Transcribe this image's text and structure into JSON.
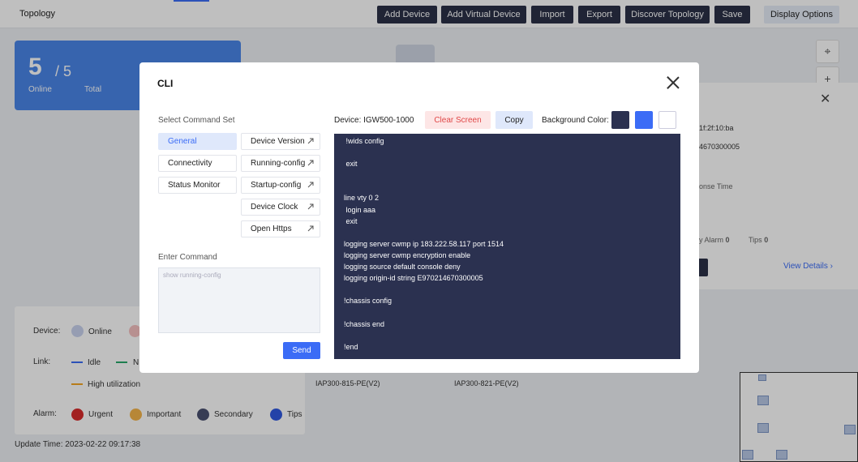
{
  "app": {
    "title": "Topology"
  },
  "toolbar": {
    "buttons": [
      {
        "label": "Add Device"
      },
      {
        "label": "Add Virtual Device"
      },
      {
        "label": "Import"
      },
      {
        "label": "Export"
      },
      {
        "label": "Discover Topology"
      },
      {
        "label": "Save"
      },
      {
        "label": "Display Options"
      }
    ]
  },
  "stats": {
    "online": "5",
    "total": "5",
    "online_label": "Online",
    "total_label": "Total"
  },
  "side_panel": {
    "mac": "1f:2f:10:ba",
    "serial": "4670300005",
    "response_label": "onse Time",
    "alarm_label": "y Alarm",
    "alarm_value": "0",
    "tips_label": "Tips",
    "tips_value": "0",
    "view_details": "View Details"
  },
  "legend": {
    "device_label": "Device:",
    "online": "Online",
    "link_label": "Link:",
    "idle": "Idle",
    "n_partial": "N",
    "high_util": "High utilization",
    "alarm_label": "Alarm:",
    "urgent": "Urgent",
    "important": "Important",
    "secondary": "Secondary",
    "tips": "Tips"
  },
  "update_time": "Update Time:  2023-02-22 09:17:38",
  "nodes": [
    "IAP300-815-PE(V2)",
    "IAP300-821-PE(V2)"
  ],
  "colors": {
    "accent": "#3b6cf6",
    "terminal_bg": "#2b3150",
    "urgent": "#d92b2b",
    "important": "#f5b54a",
    "secondary": "#4a5070",
    "tips": "#2f58e0",
    "online": "#c9d2ee",
    "idle_line": "#3b6cf6",
    "n_line": "#27a86a",
    "high_line": "#f5a623"
  },
  "modal": {
    "title": "CLI",
    "select_label": "Select Command Set",
    "categories": [
      "General",
      "Connectivity",
      "Status Monitor"
    ],
    "commands": [
      "Device Version",
      "Running-config",
      "Startup-config",
      "Device Clock",
      "Open Https"
    ],
    "enter_label": "Enter Command",
    "input_placeholder": "show running-config",
    "send": "Send",
    "device": "Device: IGW500-1000",
    "clear": "Clear Screen",
    "copy": "Copy",
    "bg_label": "Background Color:",
    "swatches": [
      "#2b3150",
      "#3b6cf6",
      "#ffffff"
    ],
    "terminal_lines": [
      " !wids config",
      "",
      " exit",
      "",
      "",
      "line vty 0 2",
      " login aaa",
      " exit",
      "",
      "logging server cwmp ip 183.222.58.117 port 1514",
      "logging server cwmp encryption enable",
      "logging source default console deny",
      "logging origin-id string E970214670300005",
      "",
      "!chassis config",
      "",
      "!chassis end",
      "",
      "!end"
    ]
  }
}
